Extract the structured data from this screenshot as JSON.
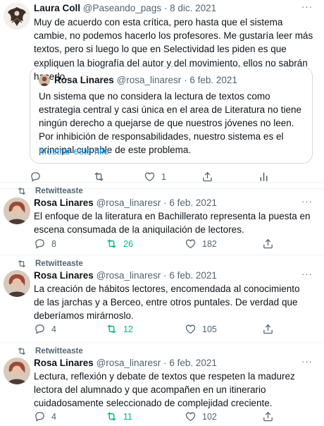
{
  "tweets": [
    {
      "name": "Laura Coll",
      "handle": "@Paseando_pags",
      "date": "· 8 dic. 2021",
      "text": "Muy de acuerdo con esta crítica, pero hasta que el sistema cambie, no podemos hacerlo los profesores. Me gustaría leer más textos, pero si luego lo que en Selectividad les piden es que expliquen la biografía del autor y del movimiento, ellos no sabrán hacerlo.",
      "quote": {
        "name": "Rosa Linares",
        "handle": "@rosa_linaresr",
        "date": "· 6 feb. 2021",
        "text": "Un sistema que no considera la lectura de textos como estrategia central y casi única en el area de Literatura no tiene ningún derecho a quejarse de que nuestros jóvenes no leen. Por inhibición de responsabilidades, nuestro sistema es el principal culpable de este problema.",
        "link": "Mostrar este hilo"
      },
      "replies": "",
      "retweets": "",
      "likes": "1"
    },
    {
      "retweet_label": "Retwitteaste",
      "name": "Rosa Linares",
      "handle": "@rosa_linaresr",
      "date": "· 6 feb. 2021",
      "text": "El enfoque de la literatura en Bachillerato representa la puesta en escena consumada de la aniquilación de lectores.",
      "replies": "8",
      "retweets": "26",
      "likes": "182"
    },
    {
      "retweet_label": "Retwitteaste",
      "name": "Rosa Linares",
      "handle": "@rosa_linaresr",
      "date": "· 6 feb. 2021",
      "text": "La creación de hábitos lectores, encomendada al conocimiento de las jarchas y a Berceo, entre otros puntales. De verdad que deberíamos mirárnoslo.",
      "replies": "4",
      "retweets": "12",
      "likes": "105"
    },
    {
      "retweet_label": "Retwitteaste",
      "name": "Rosa Linares",
      "handle": "@rosa_linaresr",
      "date": "· 6 feb. 2021",
      "text": "Lectura, reflexión y debate de textos que respeten la madurez lectora del alumnado y que acompañen en un itinerario cuidadosamente seleccionado de complejidad creciente.",
      "replies": "4",
      "retweets": "11",
      "likes": "102"
    }
  ],
  "more_label": "···",
  "colors": {
    "accent": "#1d9bf0",
    "retweet_active": "#00ba7c",
    "muted": "#536471"
  }
}
